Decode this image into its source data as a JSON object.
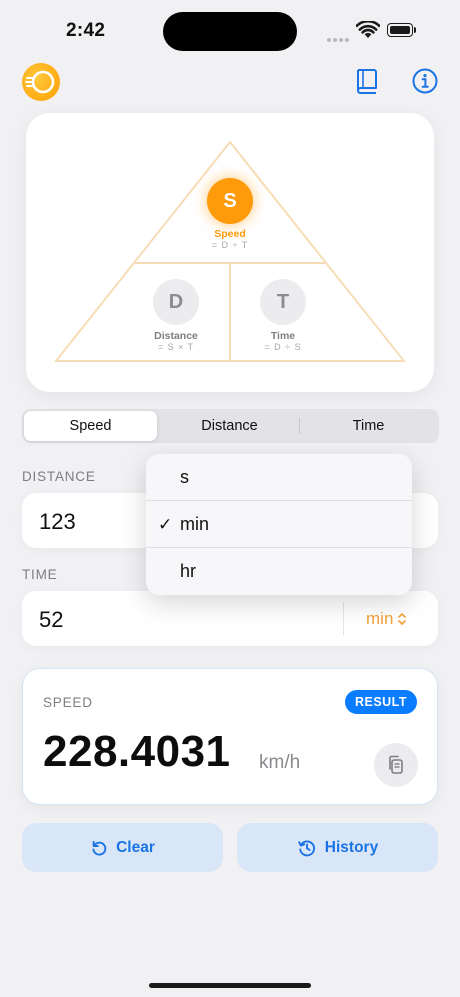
{
  "status_bar": {
    "time": "2:42"
  },
  "triangle": {
    "top": {
      "letter": "S",
      "label": "Speed",
      "formula": "= D ÷ T"
    },
    "left": {
      "letter": "D",
      "label": "Distance",
      "formula": "= S × T"
    },
    "right": {
      "letter": "T",
      "label": "Time",
      "formula": "= D ÷ S"
    }
  },
  "segments": [
    "Speed",
    "Distance",
    "Time"
  ],
  "selected_segment": "Speed",
  "distance": {
    "label": "DISTANCE",
    "value": "123"
  },
  "time": {
    "label": "TIME",
    "value": "52",
    "unit": "min"
  },
  "unit_menu": {
    "options": [
      "s",
      "min",
      "hr"
    ],
    "selected": "min",
    "check": "✓"
  },
  "result": {
    "label": "SPEED",
    "badge": "RESULT",
    "value": "228.4031",
    "unit": "km/h"
  },
  "buttons": {
    "clear": "Clear",
    "history": "History"
  },
  "colors": {
    "accent_orange": "#ff9a0a",
    "accent_blue": "#0a7cff",
    "button_bg": "#d9e6f8"
  }
}
